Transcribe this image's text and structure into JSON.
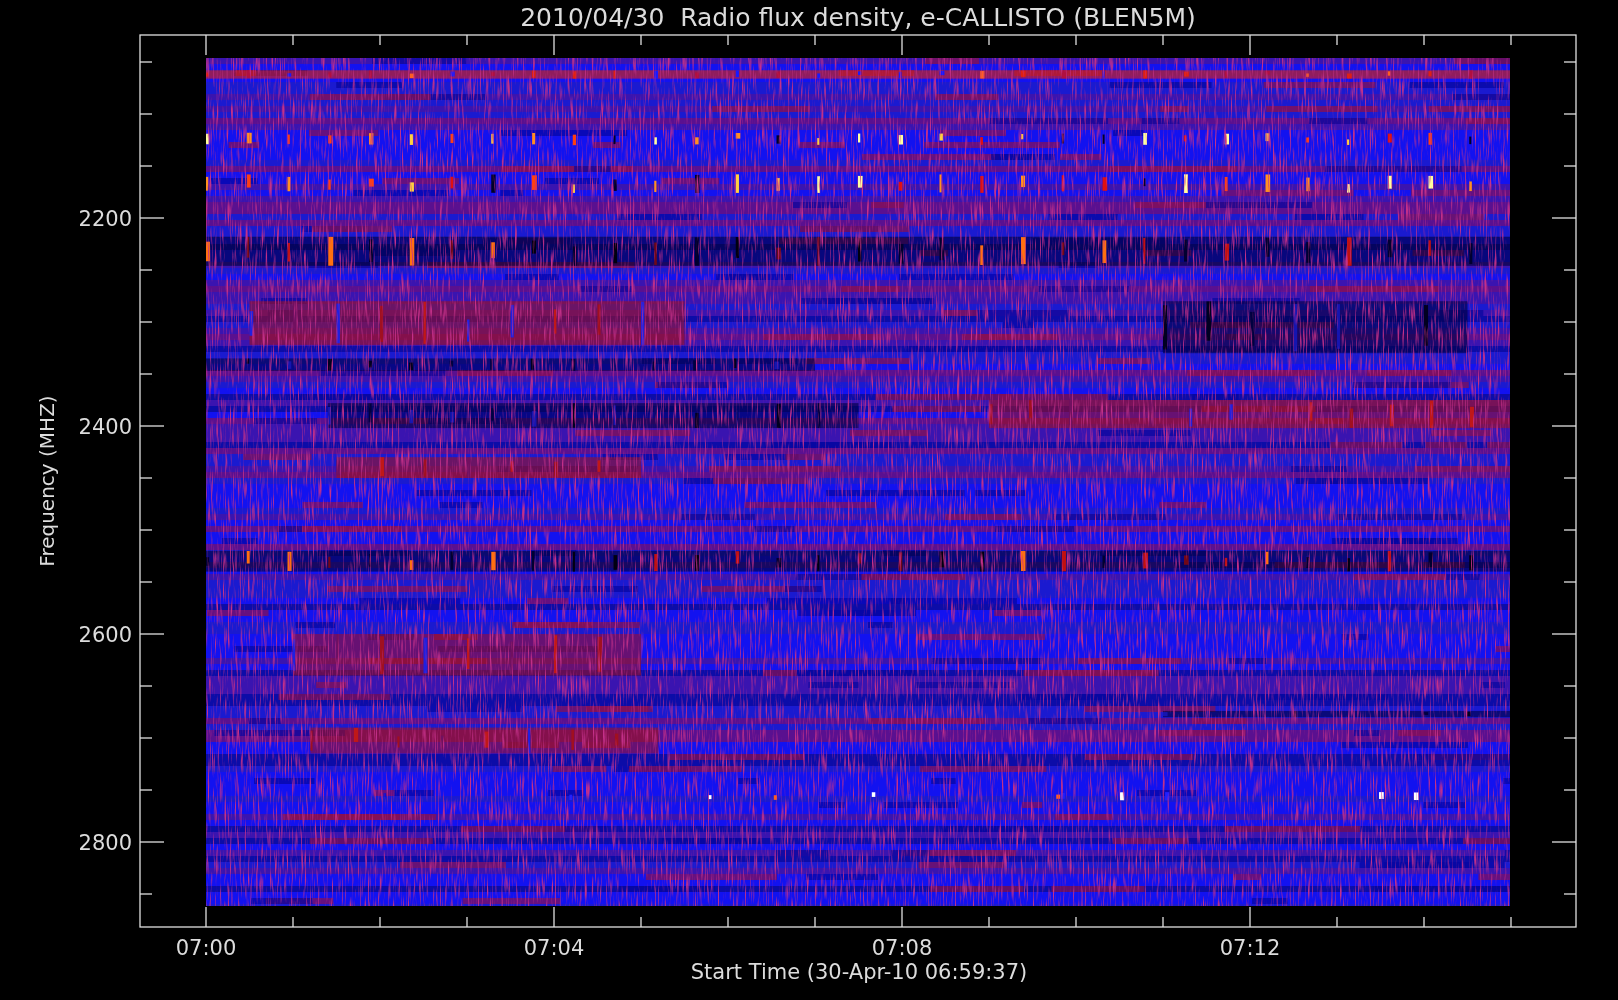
{
  "title": "2010/04/30  Radio flux density, e-CALLISTO (BLEN5M)",
  "y_axis": {
    "label": "Frequency (MHZ)",
    "ticks": [
      "2200",
      "2400",
      "2600",
      "2800"
    ]
  },
  "x_axis": {
    "label": "Start Time (30-Apr-10 06:59:37)",
    "ticks": [
      "07:00",
      "07:04",
      "07:08",
      "07:12"
    ]
  }
}
